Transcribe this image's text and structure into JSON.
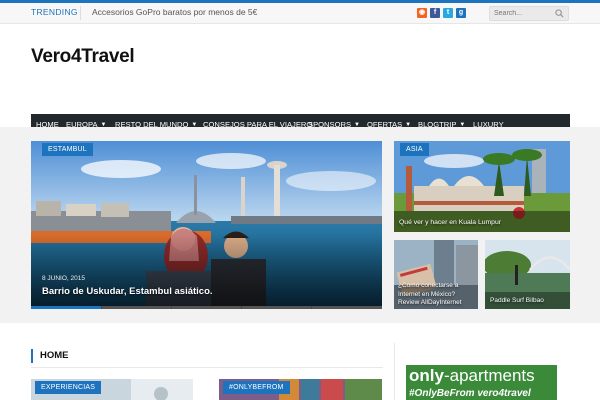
{
  "topbar": {
    "trending_label": "TRENDING",
    "trending_text": "Accesorios GoPro baratos por menos de 5€",
    "search_placeholder": "Search..."
  },
  "header": {
    "logo": "Vero4Travel"
  },
  "nav": {
    "items": [
      {
        "label": "HOME"
      },
      {
        "label": "EUROPA"
      },
      {
        "label": "RESTO DEL MUNDO"
      },
      {
        "label": "CONSEJOS PARA EL VIAJERO"
      },
      {
        "label": "SPONSORS"
      },
      {
        "label": "OFERTAS"
      },
      {
        "label": "BLOGTRIP"
      },
      {
        "label": "LUXURY"
      }
    ]
  },
  "featured": {
    "main": {
      "tag": "ESTAMBUL",
      "date": "8 JUNIO, 2015",
      "title": "Barrio de Uskudar, Estambul asiático."
    },
    "asia": {
      "tag": "ASIA",
      "title": "Qué ver y hacer en Kuala Lumpur"
    },
    "mexico": {
      "title": "¿Como conectarse a Internet en México? Review AllDayInternet"
    },
    "bilbao": {
      "title": "Paddle Surf Bilbao"
    }
  },
  "home": {
    "title": "HOME",
    "cards": [
      {
        "tag": "EXPERIENCIAS"
      },
      {
        "tag": "#ONLYBEFROM"
      }
    ]
  },
  "ad": {
    "brand_only": "only",
    "brand_rest": "-apartments",
    "hashtag": "#OnlyBeFrom vero4travel"
  },
  "colors": {
    "accent": "#1e73be",
    "nav_bg": "#23282d"
  }
}
